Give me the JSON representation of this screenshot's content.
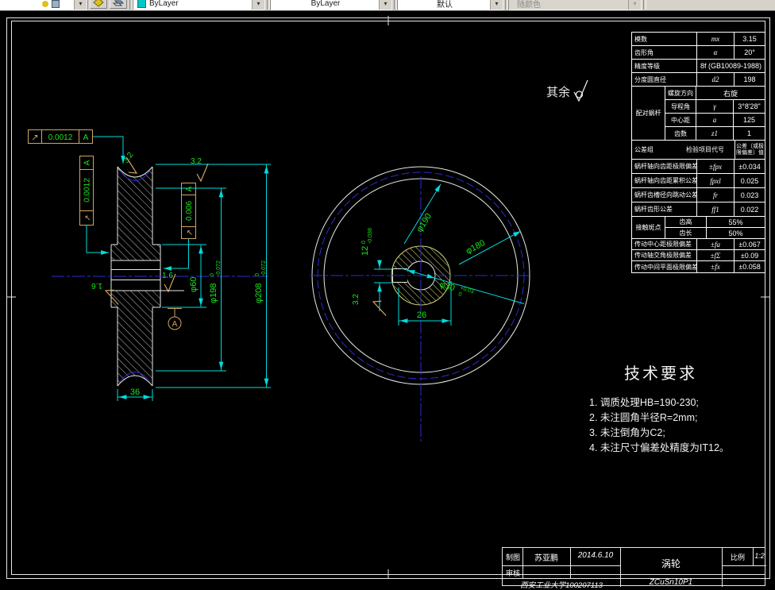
{
  "toolbar": {
    "color_value": "ByLayer",
    "linetype_value": "ByLayer",
    "lineweight_value": "默认",
    "plotstyle_value": "随颜色"
  },
  "sheet": {
    "other_roughness_label": "其余"
  },
  "gear_table": {
    "basic": [
      {
        "label": "模数",
        "sym": "mx",
        "val": "3.15"
      },
      {
        "label": "齿形角",
        "sym": "α",
        "val": "20°"
      },
      {
        "label": "精度等级",
        "sym": "",
        "val": "8f (GB10089-1988)"
      },
      {
        "label": "分度圆直径",
        "sym": "d2",
        "val": "198"
      }
    ],
    "mate": {
      "label": "配对蜗杆",
      "rows": [
        {
          "label": "螺旋方向",
          "sym": "",
          "val": "右旋"
        },
        {
          "label": "导程角",
          "sym": "γ",
          "val": "3°8'28\""
        },
        {
          "label": "中心距",
          "sym": "a",
          "val": "125"
        },
        {
          "label": "齿数",
          "sym": "z1",
          "val": "1"
        }
      ]
    },
    "header": {
      "left": "公差组",
      "mid": "检验项目代号",
      "right": "公差（或极限偏差）值"
    },
    "checks": [
      {
        "label": "蜗杆轴向齿距极限偏差",
        "sym": "±fpx",
        "val": "±0.034"
      },
      {
        "label": "蜗杆轴向齿距累积公差",
        "sym": "fpxl",
        "val": "0.025"
      },
      {
        "label": "蜗杆齿槽径向跳动公差",
        "sym": "fr",
        "val": "0.023"
      },
      {
        "label": "蜗杆齿形公差",
        "sym": "ff1",
        "val": "0.022"
      }
    ],
    "contact": {
      "label": "接触斑点",
      "rows": [
        {
          "label": "齿高",
          "val": "55%"
        },
        {
          "label": "齿长",
          "val": "50%"
        }
      ]
    },
    "trans": [
      {
        "label": "传动中心距极限偏差",
        "sym": "±fa",
        "val": "±0.067"
      },
      {
        "label": "传动轴交角极限偏差",
        "sym": "±fΣ",
        "val": "±0.09"
      },
      {
        "label": "传动中间平面极限偏差",
        "sym": "±fx",
        "val": "±0.058"
      }
    ]
  },
  "left_view": {
    "fcf_top": {
      "sym": "↗",
      "val": "0.0012",
      "datum": "A"
    },
    "fcf_left": {
      "sym": "↗",
      "val": "0.0012",
      "datum": "A"
    },
    "fcf_right": {
      "sym": "↗",
      "val": "0.006",
      "datum": "A"
    },
    "datum_label": "A",
    "rough_arc": "3.2",
    "rough_top": "3.2",
    "rough_bore": "1.6",
    "rough_left": "1.6",
    "dia60": "φ60",
    "dia198": {
      "main": "φ198",
      "sup": "0",
      "sub": "-0.072"
    },
    "dia208": {
      "main": "φ208",
      "sup": "0",
      "sub": "-0.072"
    },
    "width36": "36"
  },
  "front_view": {
    "dia190": "φ190",
    "dia180": "φ180",
    "key12": {
      "main": "12",
      "sup": "0",
      "sub": "-0.038"
    },
    "bore30": {
      "main": "φ30",
      "sup": "+0.03",
      "sub": "0"
    },
    "width26": "26",
    "rough": "3.2"
  },
  "tech_req": {
    "title": "技术要求",
    "items": [
      "1. 调质处理HB=190-230;",
      "2. 未注圆角半径R=2mm;",
      "3. 未注倒角为C2;",
      "4. 未注尺寸偏差处精度为IT12。"
    ]
  },
  "title_block": {
    "draw_label": "制图",
    "drawer": "苏亚鹏",
    "date": "2014.6.10",
    "check_label": "审核",
    "org": "西安工业大学100207113",
    "part_name": "涡轮",
    "material": "ZCuSn10P1",
    "scale_label": "比例",
    "scale_value": "1:2"
  }
}
